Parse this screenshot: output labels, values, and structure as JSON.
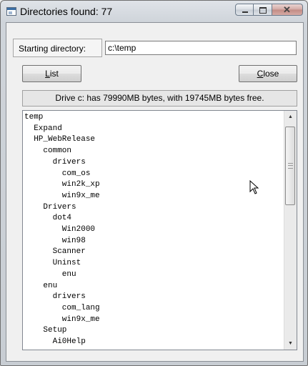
{
  "window": {
    "title": "Directories found: 77"
  },
  "form": {
    "starting_dir_label": "Starting directory:",
    "starting_dir_value": "c:\\temp",
    "list_button": "List",
    "close_button": "Close",
    "status": "Drive c: has 79990MB bytes, with 19745MB bytes free."
  },
  "tree": [
    "temp",
    "  Expand",
    "  HP_WebRelease",
    "    common",
    "      drivers",
    "        com_os",
    "        win2k_xp",
    "        win9x_me",
    "    Drivers",
    "      dot4",
    "        Win2000",
    "        win98",
    "      Scanner",
    "      Uninst",
    "        enu",
    "    enu",
    "      drivers",
    "        com_lang",
    "        win9x_me",
    "    Setup",
    "      Ai0Help"
  ]
}
